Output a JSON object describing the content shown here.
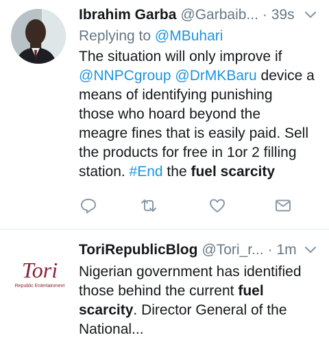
{
  "tweets": [
    {
      "name": "Ibrahim Garba",
      "handle": "@Garbaib...",
      "time": "· 39s",
      "replying_prefix": "Replying to ",
      "replying_to": "@MBuhari",
      "text": {
        "t1": "The situation will only improve if",
        "m1": "@NNPCgroup",
        "m2": "@DrMKBaru",
        "t2": " device a\nmeans of identifying punishing\nthose who hoard beyond the\nmeagre fines that is easily paid. Sell\nthe products for free in 1or 2 filling\nstation. ",
        "hashtag": "#End",
        "t3": " the ",
        "bold": "fuel scarcity"
      },
      "actions": [
        "reply-icon",
        "retweet-icon",
        "like-icon",
        "direct-message-icon"
      ]
    },
    {
      "name": "ToriRepublicBlog",
      "handle": "@Tori_r...",
      "time": "· 1m",
      "avatar_logo": "Tori",
      "avatar_tagline": "Republic Entertainment",
      "text": {
        "t1": "Nigerian government has identified\nthose behind the current ",
        "bold1": "fuel\nscarcity",
        "t2": ". Director General of the\nNational..."
      }
    }
  ],
  "colors": {
    "link": "#1b95e0",
    "secondary": "#657786",
    "primary": "#14171a",
    "tori_brand": "#8b2035"
  }
}
